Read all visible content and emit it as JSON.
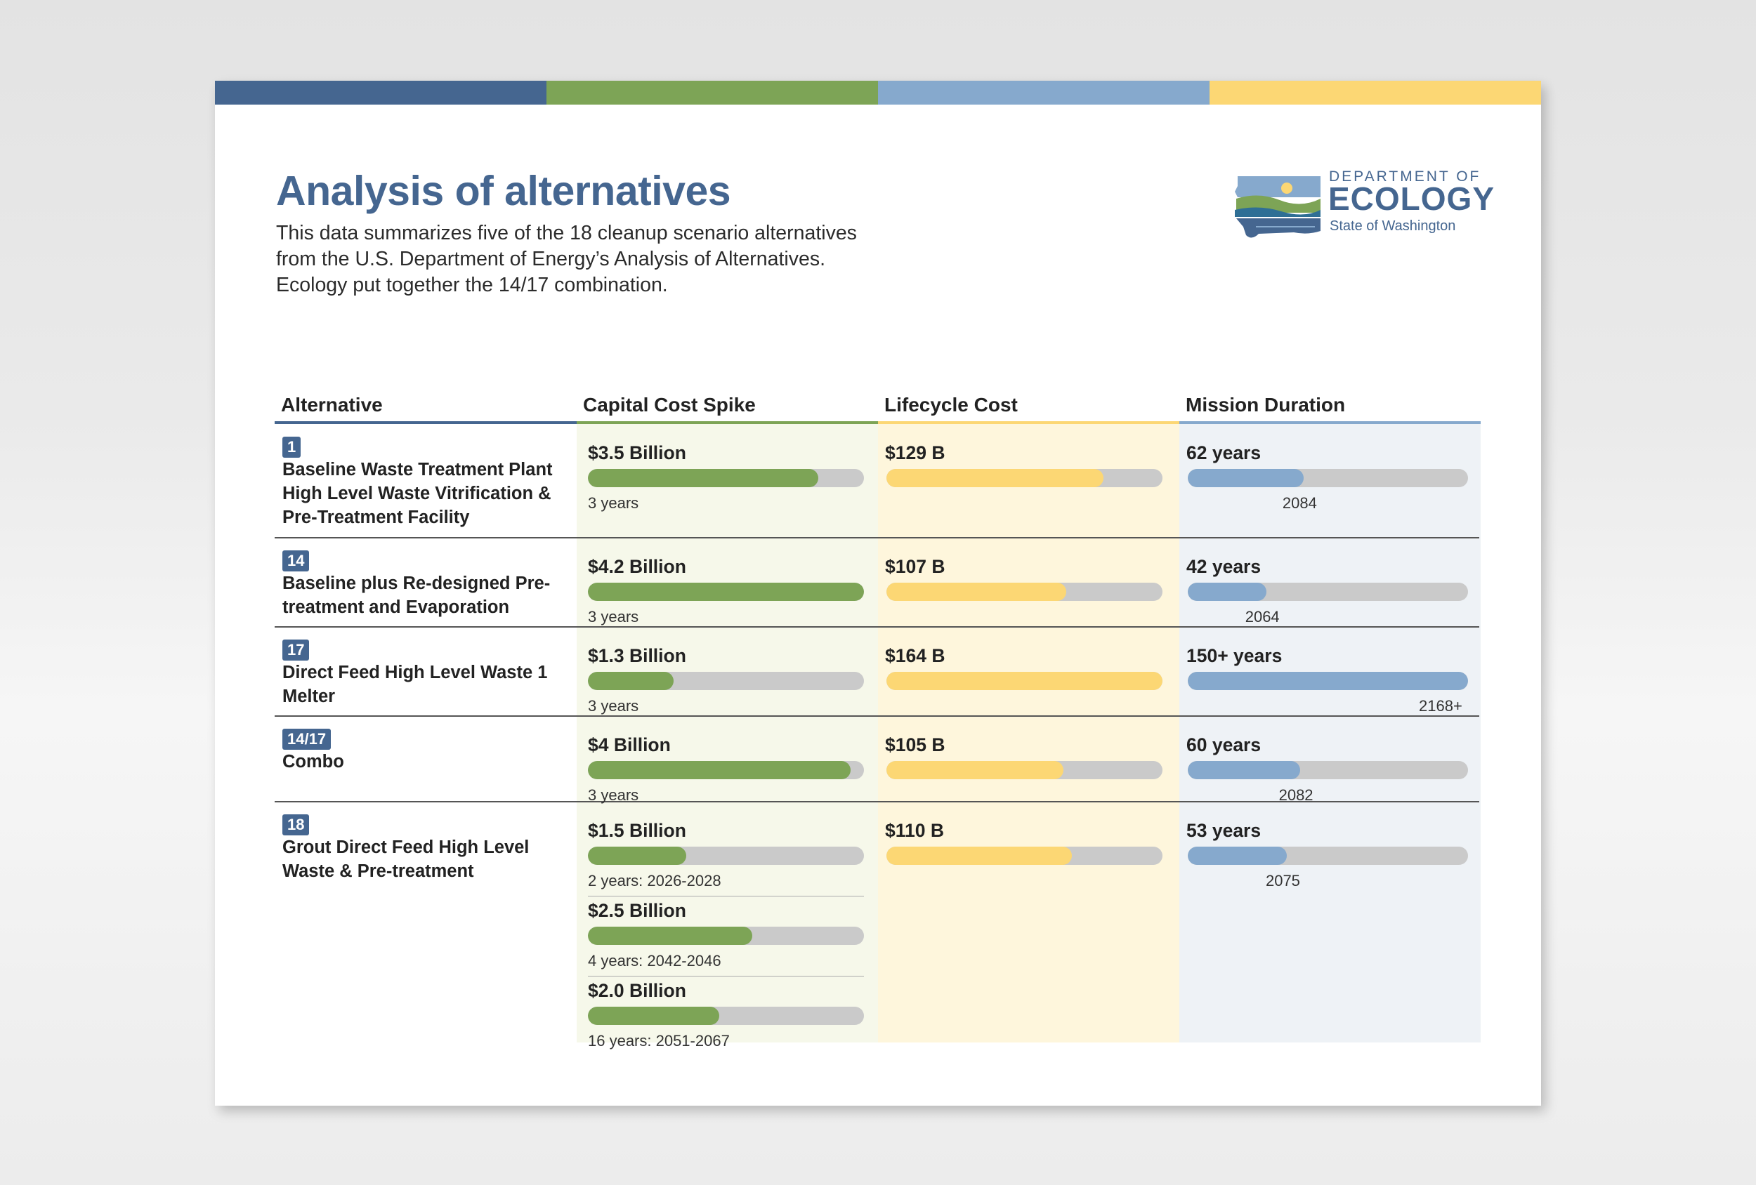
{
  "title": "Analysis of alternatives",
  "intro": "This data summarizes five of the 18 cleanup scenario alternatives from the U.S. Department of Energy’s Analysis of Alternatives. Ecology put together the 14/17 combination.",
  "logo": {
    "line1": "DEPARTMENT OF",
    "line2": "ECOLOGY",
    "line3": "State of Washington"
  },
  "colors": {
    "blue_dark": "#456690",
    "green": "#7da456",
    "blue_light": "#86a9cd",
    "yellow": "#fcd774",
    "track": "#cacaca",
    "green_bg": "#f6f8ea",
    "yellow_bg": "#fef6dc",
    "blue_bg": "#eef2f6"
  },
  "columns": [
    "Alternative",
    "Capital Cost Spike",
    "Lifecycle Cost",
    "Mission Duration"
  ],
  "chart_data": {
    "type": "table",
    "scales": {
      "capital_max_billion": 4.2,
      "lifecycle_max_billion": 164,
      "duration_max_years": 150
    },
    "rows": [
      {
        "id": "1",
        "name": "Baseline Waste Treatment Plant High Level Waste Vitrification & Pre-Treatment Facility",
        "capital": [
          {
            "label": "$3.5 Billion",
            "value": 3.5,
            "note": "3 years"
          }
        ],
        "lifecycle": {
          "label": "$129 B",
          "value": 129
        },
        "duration": {
          "label": "62 years",
          "value": 62,
          "end_year": "2084"
        }
      },
      {
        "id": "14",
        "name": "Baseline plus Re-designed Pre-treatment and Evaporation",
        "capital": [
          {
            "label": "$4.2 Billion",
            "value": 4.2,
            "note": "3 years"
          }
        ],
        "lifecycle": {
          "label": "$107 B",
          "value": 107
        },
        "duration": {
          "label": "42 years",
          "value": 42,
          "end_year": "2064"
        }
      },
      {
        "id": "17",
        "name": "Direct Feed High Level Waste 1 Melter",
        "capital": [
          {
            "label": "$1.3 Billion",
            "value": 1.3,
            "note": "3 years"
          }
        ],
        "lifecycle": {
          "label": "$164 B",
          "value": 164
        },
        "duration": {
          "label": "150+ years",
          "value": 150,
          "end_year": "2168+"
        }
      },
      {
        "id": "14/17",
        "name": "Combo",
        "capital": [
          {
            "label": "$4 Billion",
            "value": 4.0,
            "note": "3 years"
          }
        ],
        "lifecycle": {
          "label": "$105 B",
          "value": 105
        },
        "duration": {
          "label": "60 years",
          "value": 60,
          "end_year": "2082"
        }
      },
      {
        "id": "18",
        "name": "Grout Direct Feed High Level Waste & Pre-treatment",
        "capital": [
          {
            "label": "$1.5 Billion",
            "value": 1.5,
            "note": "2 years: 2026-2028"
          },
          {
            "label": "$2.5 Billion",
            "value": 2.5,
            "note": "4 years: 2042-2046"
          },
          {
            "label": "$2.0 Billion",
            "value": 2.0,
            "note": "16 years: 2051-2067"
          }
        ],
        "lifecycle": {
          "label": "$110 B",
          "value": 110
        },
        "duration": {
          "label": "53 years",
          "value": 53,
          "end_year": "2075"
        }
      }
    ]
  }
}
